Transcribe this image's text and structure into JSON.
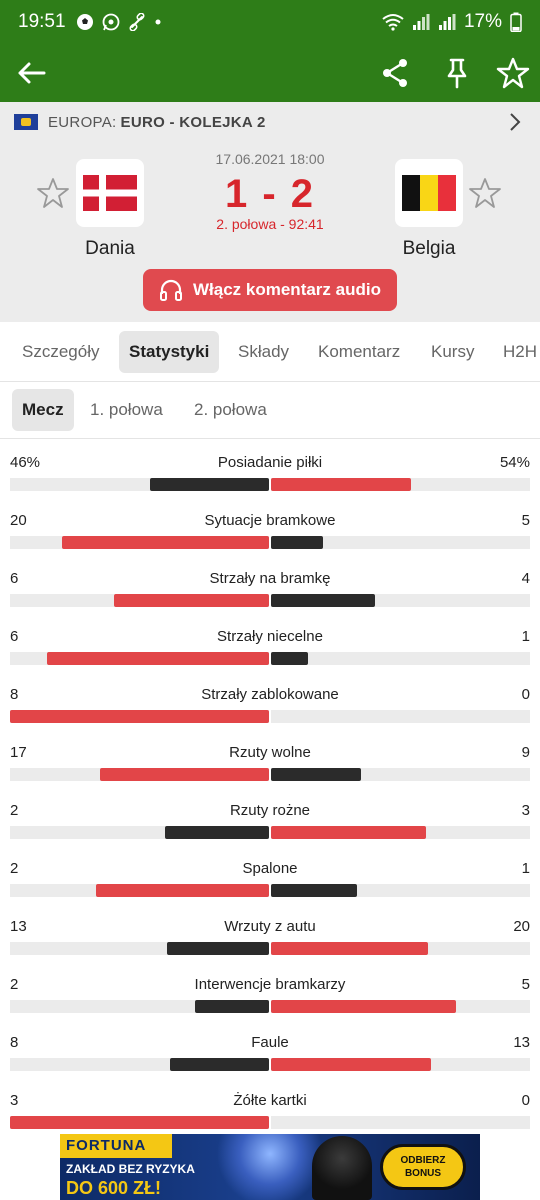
{
  "status_bar": {
    "time": "19:51",
    "left_icons": [
      "soccer-ball-icon",
      "whatsapp-icon",
      "link-icon",
      "dot-icon"
    ],
    "battery": "17%"
  },
  "league": {
    "region": "EUROPA:",
    "name": "EURO - KOLEJKA 2"
  },
  "match": {
    "datetime": "17.06.2021 18:00",
    "score": "1 - 2",
    "period": "2. połowa - 92:41",
    "home": {
      "name": "Dania"
    },
    "away": {
      "name": "Belgia"
    },
    "audio_button": "Włącz komentarz audio"
  },
  "tabs": [
    "Szczegóły",
    "Statystyki",
    "Składy",
    "Komentarz",
    "Kursy",
    "H2H"
  ],
  "active_tab": "Statystyki",
  "subtabs": [
    "Mecz",
    "1. połowa",
    "2. połowa"
  ],
  "active_subtab": "Mecz",
  "colors": {
    "brand_green": "#2e7d18",
    "accent_red": "#e24548",
    "dark_bar": "#2b2b2b",
    "track": "#ebebeb"
  },
  "stats": [
    {
      "label": "Posiadanie piłki",
      "home": "46%",
      "away": "54%",
      "home_value": 46,
      "away_value": 54
    },
    {
      "label": "Sytuacje bramkowe",
      "home": "20",
      "away": "5",
      "home_value": 20,
      "away_value": 5
    },
    {
      "label": "Strzały na bramkę",
      "home": "6",
      "away": "4",
      "home_value": 6,
      "away_value": 4
    },
    {
      "label": "Strzały niecelne",
      "home": "6",
      "away": "1",
      "home_value": 6,
      "away_value": 1
    },
    {
      "label": "Strzały zablokowane",
      "home": "8",
      "away": "0",
      "home_value": 8,
      "away_value": 0
    },
    {
      "label": "Rzuty wolne",
      "home": "17",
      "away": "9",
      "home_value": 17,
      "away_value": 9
    },
    {
      "label": "Rzuty rożne",
      "home": "2",
      "away": "3",
      "home_value": 2,
      "away_value": 3
    },
    {
      "label": "Spalone",
      "home": "2",
      "away": "1",
      "home_value": 2,
      "away_value": 1
    },
    {
      "label": "Wrzuty z autu",
      "home": "13",
      "away": "20",
      "home_value": 13,
      "away_value": 20
    },
    {
      "label": "Interwencje bramkarzy",
      "home": "2",
      "away": "5",
      "home_value": 2,
      "away_value": 5
    },
    {
      "label": "Faule",
      "home": "8",
      "away": "13",
      "home_value": 8,
      "away_value": 13
    },
    {
      "label": "Żółte kartki",
      "home": "3",
      "away": "0",
      "home_value": 3,
      "away_value": 0
    }
  ],
  "ad": {
    "brand": "FORTUNA",
    "line1": "ZAKŁAD BEZ RYZYKA",
    "line2": "DO 600 ZŁ!",
    "cta_line1": "ODBIERZ",
    "cta_line2": "BONUS"
  }
}
